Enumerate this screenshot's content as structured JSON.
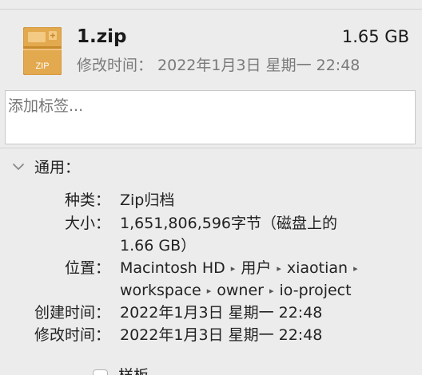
{
  "file": {
    "name": "1.zip",
    "size": "1.65 GB",
    "icon": "zip-archive-icon",
    "icon_label": "ZIP",
    "modified_label": "修改时间：",
    "modified_value": "2022年1月3日 星期一 22:48"
  },
  "tags": {
    "placeholder": "添加标签..."
  },
  "general": {
    "title": "通用：",
    "expanded": true,
    "kind": {
      "label": "种类：",
      "value": "Zip归档"
    },
    "size": {
      "label": "大小：",
      "value_line1": "1,651,806,596字节（磁盘上的",
      "value_line2": "1.66 GB）"
    },
    "where": {
      "label": "位置：",
      "path": [
        "Macintosh HD",
        "用户",
        "xiaotian",
        "workspace",
        "owner",
        "io-project"
      ],
      "separator": "▸"
    },
    "created": {
      "label": "创建时间：",
      "value": "2022年1月3日 星期一 22:48"
    },
    "modified": {
      "label": "修改时间：",
      "value": "2022年1月3日 星期一 22:48"
    },
    "stationery_label": "样板"
  },
  "colors": {
    "icon_body": "#e0a64a",
    "icon_band": "#c98a2e",
    "background": "#ececec",
    "secondary_text": "#7a7a7a"
  }
}
